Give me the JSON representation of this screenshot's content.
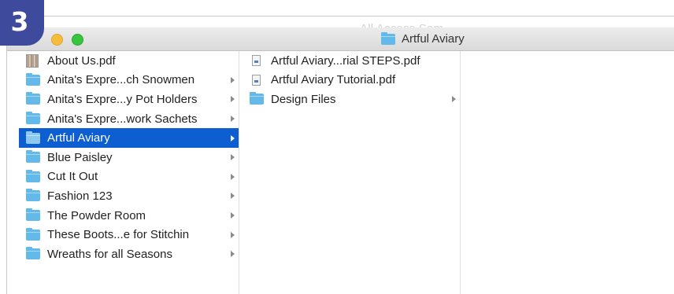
{
  "window": {
    "behind_title": "All Access Sam",
    "title": "Artful Aviary"
  },
  "step_badge": "3",
  "column1": {
    "items": [
      {
        "label": "About Us.pdf",
        "type": "pdf",
        "selected": false,
        "has_children": false
      },
      {
        "label": "Anita's Expre...ch Snowmen",
        "type": "folder",
        "selected": false,
        "has_children": true
      },
      {
        "label": "Anita's Expre...y Pot Holders",
        "type": "folder",
        "selected": false,
        "has_children": true
      },
      {
        "label": "Anita's Expre...work Sachets",
        "type": "folder",
        "selected": false,
        "has_children": true
      },
      {
        "label": "Artful Aviary",
        "type": "folder",
        "selected": true,
        "has_children": true
      },
      {
        "label": "Blue Paisley",
        "type": "folder",
        "selected": false,
        "has_children": true
      },
      {
        "label": "Cut It Out",
        "type": "folder",
        "selected": false,
        "has_children": true
      },
      {
        "label": "Fashion 123",
        "type": "folder",
        "selected": false,
        "has_children": true
      },
      {
        "label": "The Powder Room",
        "type": "folder",
        "selected": false,
        "has_children": true
      },
      {
        "label": "These Boots...e for Stitchin",
        "type": "folder",
        "selected": false,
        "has_children": true
      },
      {
        "label": "Wreaths for all Seasons",
        "type": "folder",
        "selected": false,
        "has_children": true
      }
    ]
  },
  "column2": {
    "items": [
      {
        "label": "Artful Aviary...rial STEPS.pdf",
        "type": "pdf",
        "has_children": false
      },
      {
        "label": "Artful Aviary Tutorial.pdf",
        "type": "pdf",
        "has_children": false
      },
      {
        "label": "Design Files",
        "type": "folder",
        "has_children": true
      }
    ]
  },
  "colors": {
    "selection": "#0d5fd1",
    "folder": "#63b9ea",
    "badge": "#3e4a9b"
  }
}
